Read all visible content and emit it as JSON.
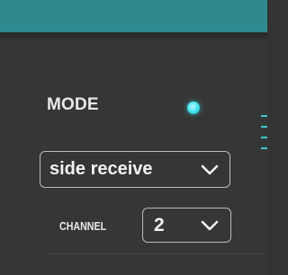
{
  "mode": {
    "label": "MODE",
    "indicator": {
      "state": "active",
      "color": "#4ee6f2"
    },
    "select": {
      "value": "side receive",
      "icon": "chevron-down-icon"
    }
  },
  "channel": {
    "label": "CHANNEL",
    "select": {
      "value": "2",
      "icon": "chevron-down-icon"
    }
  },
  "colors": {
    "header_accent": "#2f8a8e",
    "background": "#363636",
    "text": "#f2f2f2"
  }
}
